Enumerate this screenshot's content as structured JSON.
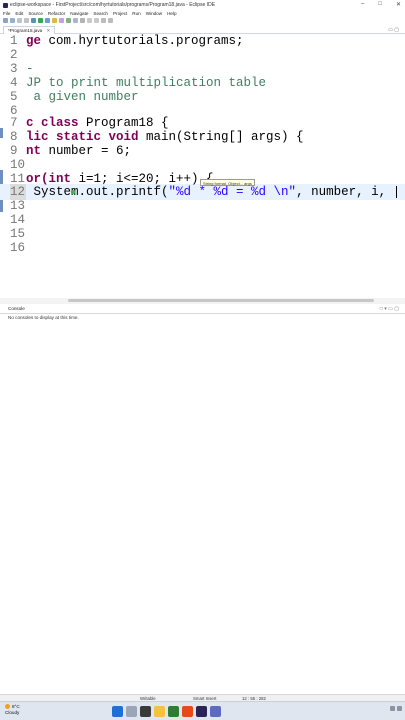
{
  "window": {
    "title": "eclipse-workspace - FirstProject/src/com/hyrtutorials/programs/Program18.java - Eclipse IDE",
    "controls": [
      "–",
      "□",
      "✕"
    ]
  },
  "menu": [
    "File",
    "Edit",
    "Source",
    "Refactor",
    "Navigate",
    "Search",
    "Project",
    "Run",
    "Window",
    "Help"
  ],
  "editor": {
    "tab_label": "*Program18.java",
    "tab_close": "✕",
    "tab_ctrls": "▭ ▢",
    "lines": [
      {
        "n": "1",
        "segments": [
          {
            "t": "ge ",
            "c": "kw"
          },
          {
            "t": "com.hyrtutorials.programs;",
            "c": ""
          }
        ]
      },
      {
        "n": "2",
        "segments": []
      },
      {
        "n": "3",
        "segments": [
          {
            "t": "-",
            "c": "cm"
          }
        ]
      },
      {
        "n": "4",
        "segments": [
          {
            "t": "JP to print multiplication table",
            "c": "cm"
          }
        ]
      },
      {
        "n": "5",
        "segments": [
          {
            "t": " a given number",
            "c": "cm"
          }
        ]
      },
      {
        "n": "6",
        "segments": []
      },
      {
        "n": "7",
        "segments": [
          {
            "t": "c class ",
            "c": "kw"
          },
          {
            "t": "Program18 {",
            "c": ""
          }
        ]
      },
      {
        "n": "8",
        "segments": [
          {
            "t": "lic static void ",
            "c": "kw"
          },
          {
            "t": "main(String[] args) {",
            "c": ""
          }
        ]
      },
      {
        "n": "9",
        "segments": [
          {
            "t": "nt ",
            "c": "kw"
          },
          {
            "t": "number = 6;",
            "c": ""
          }
        ]
      },
      {
        "n": "10",
        "segments": []
      },
      {
        "n": "11",
        "segments": [
          {
            "t": "or(",
            "c": "kw"
          },
          {
            "t": "int ",
            "c": "kw"
          },
          {
            "t": "i=1; i<=20; i++) {",
            "c": ""
          }
        ]
      },
      {
        "n": "12",
        "segments": [
          {
            "t": " System.out.printf(",
            "c": ""
          },
          {
            "t": "\"%d * %d = %d \\n\"",
            "c": "st"
          },
          {
            "t": ", number, i, ",
            "c": ""
          }
        ]
      },
      {
        "n": "13",
        "segments": []
      },
      {
        "n": "14",
        "segments": []
      },
      {
        "n": "15",
        "segments": []
      },
      {
        "n": "16",
        "segments": []
      }
    ],
    "tooltip": "String format, Object... args"
  },
  "console": {
    "tab_label": "Console",
    "ctrls": "□ ▾ ▭ ▢",
    "message": "No consoles to display at this time."
  },
  "status": {
    "writable": "Writable",
    "insert_mode": "Smart Insert",
    "position": "12 : 55 : 282"
  },
  "taskbar": {
    "temperature": "8°C",
    "condition": "Cloudy"
  }
}
